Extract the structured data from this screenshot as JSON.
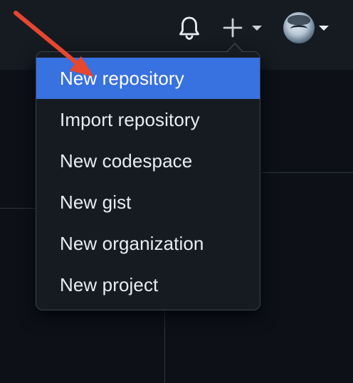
{
  "header": {
    "notifications_icon": "bell-icon",
    "create_icon": "plus-icon",
    "avatar_icon": "user-avatar"
  },
  "menu": {
    "items": [
      {
        "label": "New repository"
      },
      {
        "label": "Import repository"
      },
      {
        "label": "New codespace"
      },
      {
        "label": "New gist"
      },
      {
        "label": "New organization"
      },
      {
        "label": "New project"
      }
    ],
    "active_index": 0
  },
  "colors": {
    "header_bg": "#161b22",
    "page_bg": "#0d1117",
    "active_item": "#3871e0",
    "annotation_arrow": "#e8472f"
  }
}
